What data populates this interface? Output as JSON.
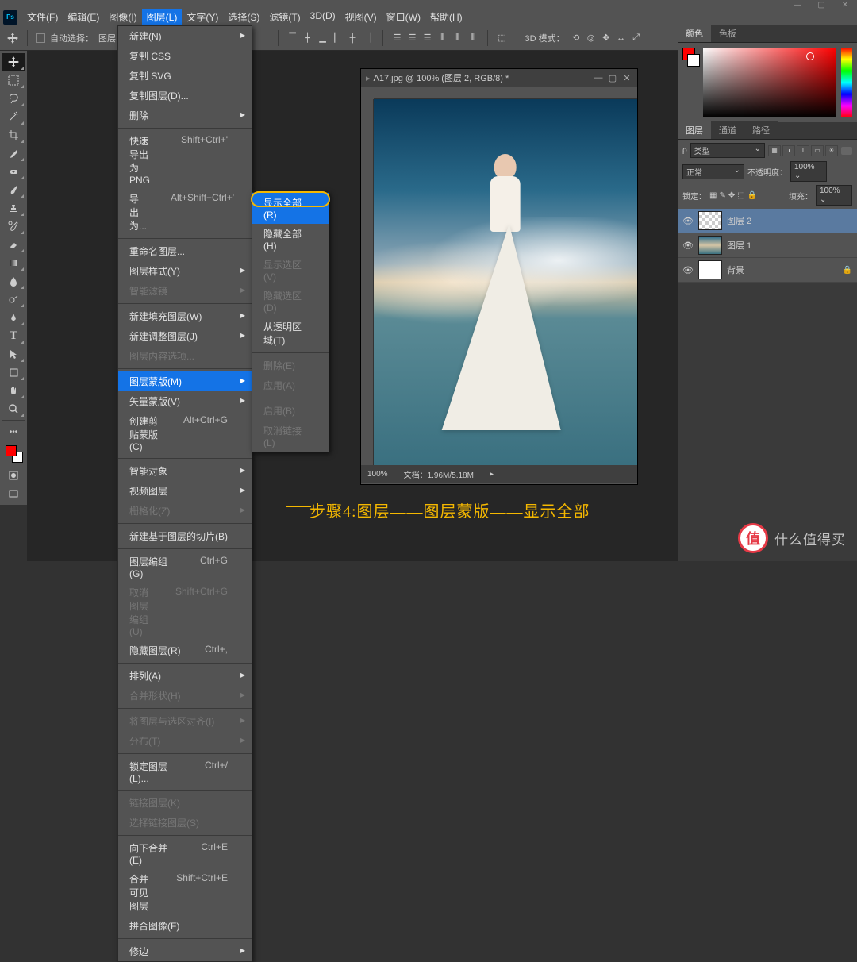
{
  "menubar": {
    "items": [
      "文件(F)",
      "编辑(E)",
      "图像(I)",
      "图层(L)",
      "文字(Y)",
      "选择(S)",
      "滤镜(T)",
      "3D(D)",
      "视图(V)",
      "窗口(W)",
      "帮助(H)"
    ],
    "open_index": 3
  },
  "options_bar": {
    "auto_select_label": "自动选择：",
    "auto_select_target": "图层",
    "mode_3d_label": "3D 模式："
  },
  "layer_menu": {
    "items": [
      {
        "label": "新建(N)",
        "arrow": true
      },
      {
        "label": "复制 CSS"
      },
      {
        "label": "复制 SVG"
      },
      {
        "label": "复制图层(D)..."
      },
      {
        "label": "删除",
        "arrow": true
      },
      {
        "sep": true
      },
      {
        "label": "快速导出为 PNG",
        "shortcut": "Shift+Ctrl+'"
      },
      {
        "label": "导出为...",
        "shortcut": "Alt+Shift+Ctrl+'"
      },
      {
        "sep": true
      },
      {
        "label": "重命名图层..."
      },
      {
        "label": "图层样式(Y)",
        "arrow": true
      },
      {
        "label": "智能滤镜",
        "disabled": true,
        "arrow": true
      },
      {
        "sep": true
      },
      {
        "label": "新建填充图层(W)",
        "arrow": true
      },
      {
        "label": "新建调整图层(J)",
        "arrow": true
      },
      {
        "label": "图层内容选项...",
        "disabled": true
      },
      {
        "sep": true
      },
      {
        "label": "图层蒙版(M)",
        "hl": true,
        "arrow": true
      },
      {
        "label": "矢量蒙版(V)",
        "arrow": true
      },
      {
        "label": "创建剪贴蒙版(C)",
        "shortcut": "Alt+Ctrl+G"
      },
      {
        "sep": true
      },
      {
        "label": "智能对象",
        "arrow": true
      },
      {
        "label": "视频图层",
        "arrow": true
      },
      {
        "label": "栅格化(Z)",
        "disabled": true,
        "arrow": true
      },
      {
        "sep": true
      },
      {
        "label": "新建基于图层的切片(B)"
      },
      {
        "sep": true
      },
      {
        "label": "图层编组(G)",
        "shortcut": "Ctrl+G"
      },
      {
        "label": "取消图层编组(U)",
        "shortcut": "Shift+Ctrl+G",
        "disabled": true
      },
      {
        "label": "隐藏图层(R)",
        "shortcut": "Ctrl+,"
      },
      {
        "sep": true
      },
      {
        "label": "排列(A)",
        "arrow": true
      },
      {
        "label": "合并形状(H)",
        "disabled": true,
        "arrow": true
      },
      {
        "sep": true
      },
      {
        "label": "将图层与选区对齐(I)",
        "arrow": true,
        "disabled": true
      },
      {
        "label": "分布(T)",
        "disabled": true,
        "arrow": true
      },
      {
        "sep": true
      },
      {
        "label": "锁定图层(L)...",
        "shortcut": "Ctrl+/"
      },
      {
        "sep": true
      },
      {
        "label": "链接图层(K)",
        "disabled": true
      },
      {
        "label": "选择链接图层(S)",
        "disabled": true
      },
      {
        "sep": true
      },
      {
        "label": "向下合并(E)",
        "shortcut": "Ctrl+E"
      },
      {
        "label": "合并可见图层",
        "shortcut": "Shift+Ctrl+E"
      },
      {
        "label": "拼合图像(F)"
      },
      {
        "sep": true
      },
      {
        "label": "修边",
        "arrow": true
      }
    ]
  },
  "submenu": {
    "items": [
      {
        "label": "显示全部(R)",
        "hl": true
      },
      {
        "label": "隐藏全部(H)"
      },
      {
        "label": "显示选区(V)",
        "disabled": true
      },
      {
        "label": "隐藏选区(D)",
        "disabled": true
      },
      {
        "label": "从透明区域(T)"
      },
      {
        "sep": true
      },
      {
        "label": "删除(E)",
        "disabled": true
      },
      {
        "label": "应用(A)",
        "disabled": true
      },
      {
        "sep": true
      },
      {
        "label": "启用(B)",
        "disabled": true
      },
      {
        "label": "取消链接(L)",
        "disabled": true
      }
    ]
  },
  "document": {
    "title": "A17.jpg @ 100% (图层 2, RGB/8) *",
    "zoom": "100%",
    "filesize": "文档：1.96M/5.18M"
  },
  "panels": {
    "color_tabs": [
      "颜色",
      "色板"
    ],
    "layer_tabs": [
      "图层",
      "通道",
      "路径"
    ],
    "kind_label": "类型",
    "blend_mode": "正常",
    "opacity_label": "不透明度：",
    "opacity_value": "100%",
    "lock_label": "锁定：",
    "fill_label": "填充：",
    "fill_value": "100%",
    "lock_icons": [
      "▦",
      "✎",
      "✥",
      "⬚",
      "🔒"
    ],
    "filter_icons": [
      "▦",
      "◑",
      "T",
      "▭",
      "☀"
    ],
    "layers": [
      {
        "name": "图层 2",
        "selected": true,
        "thumb": "checker"
      },
      {
        "name": "图层 1",
        "thumb": "img"
      },
      {
        "name": "背景",
        "thumb": "white",
        "locked": true
      }
    ]
  },
  "annotation": {
    "text": "步骤4:图层——图层蒙版——显示全部"
  },
  "watermark": {
    "symbol": "值",
    "text": "什么值得买"
  }
}
